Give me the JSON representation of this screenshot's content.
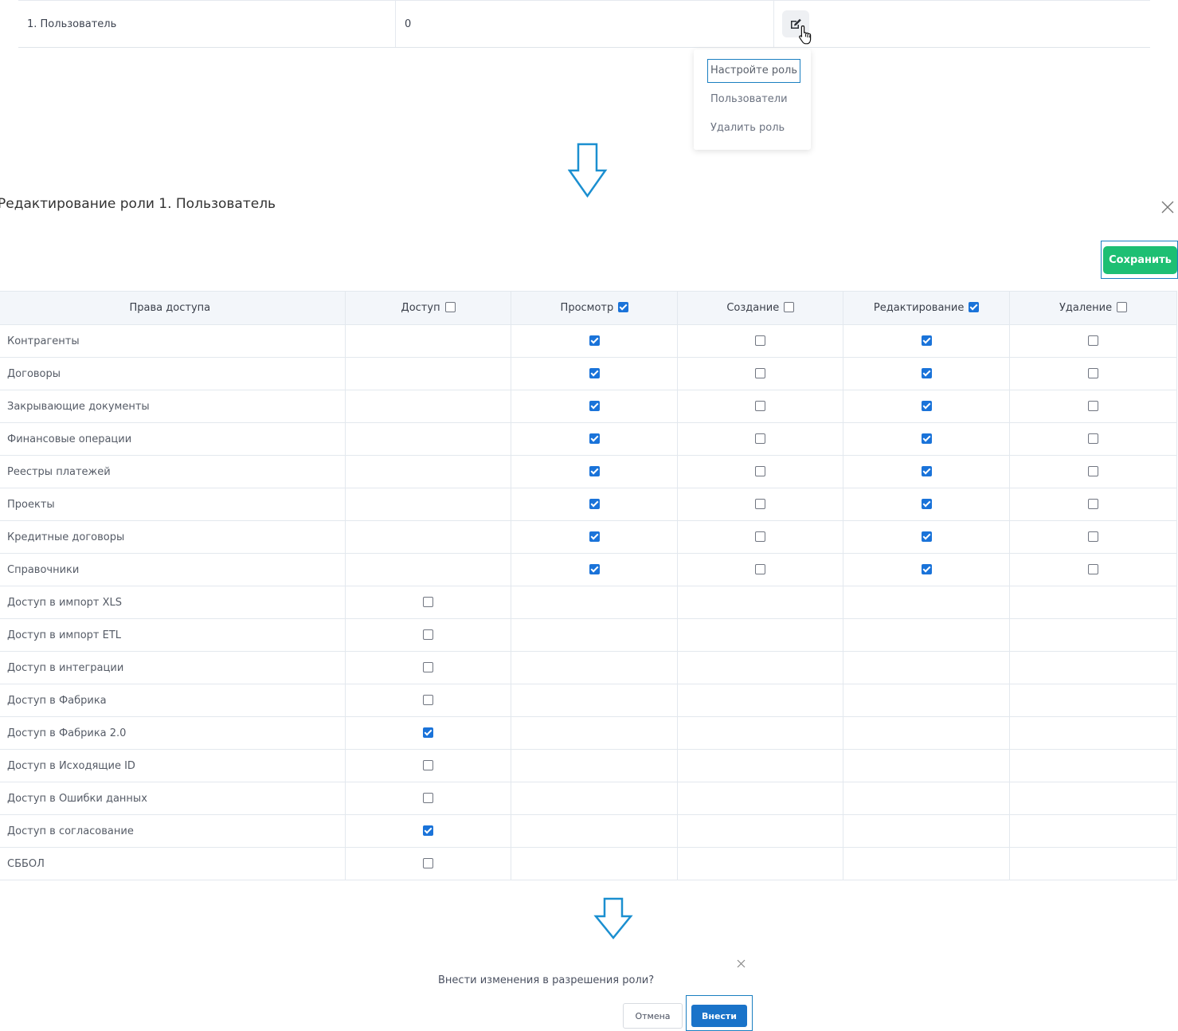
{
  "role_row": {
    "name": "1. Пользователь",
    "count": "0"
  },
  "dropdown": [
    "Настройте роль",
    "Пользователи",
    "Удалить роль"
  ],
  "modal": {
    "title": "Редактирование роли 1. Пользователь",
    "save_label": "Сохранить"
  },
  "columns": [
    {
      "label": "Права доступа"
    },
    {
      "label": "Доступ",
      "checked": false
    },
    {
      "label": "Просмотр",
      "checked": true
    },
    {
      "label": "Создание",
      "checked": false
    },
    {
      "label": "Редактирование",
      "checked": true
    },
    {
      "label": "Удаление",
      "checked": false
    }
  ],
  "rows": [
    {
      "name": "Контрагенты",
      "cells": [
        null,
        true,
        false,
        true,
        false
      ]
    },
    {
      "name": "Договоры",
      "cells": [
        null,
        true,
        false,
        true,
        false
      ]
    },
    {
      "name": "Закрывающие документы",
      "cells": [
        null,
        true,
        false,
        true,
        false
      ]
    },
    {
      "name": "Финансовые операции",
      "cells": [
        null,
        true,
        false,
        true,
        false
      ]
    },
    {
      "name": "Реестры платежей",
      "cells": [
        null,
        true,
        false,
        true,
        false
      ]
    },
    {
      "name": "Проекты",
      "cells": [
        null,
        true,
        false,
        true,
        false
      ]
    },
    {
      "name": "Кредитные договоры",
      "cells": [
        null,
        true,
        false,
        true,
        false
      ]
    },
    {
      "name": "Справочники",
      "cells": [
        null,
        true,
        false,
        true,
        false
      ]
    },
    {
      "name": "Доступ в импорт XLS",
      "cells": [
        false,
        null,
        null,
        null,
        null
      ]
    },
    {
      "name": "Доступ в импорт ETL",
      "cells": [
        false,
        null,
        null,
        null,
        null
      ]
    },
    {
      "name": "Доступ в интеграции",
      "cells": [
        false,
        null,
        null,
        null,
        null
      ]
    },
    {
      "name": "Доступ в Фабрика",
      "cells": [
        false,
        null,
        null,
        null,
        null
      ]
    },
    {
      "name": "Доступ в Фабрика 2.0",
      "cells": [
        true,
        null,
        null,
        null,
        null
      ]
    },
    {
      "name": "Доступ в Исходящие ID",
      "cells": [
        false,
        null,
        null,
        null,
        null
      ]
    },
    {
      "name": "Доступ в Ошибки данных",
      "cells": [
        false,
        null,
        null,
        null,
        null
      ]
    },
    {
      "name": "Доступ в согласование",
      "cells": [
        true,
        null,
        null,
        null,
        null
      ]
    },
    {
      "name": "СББОЛ",
      "cells": [
        false,
        null,
        null,
        null,
        null
      ]
    }
  ],
  "confirm": {
    "text": "Внести изменения в разрешения роли?",
    "cancel_label": "Отмена",
    "apply_label": "Внести"
  },
  "colors": {
    "accent": "#1a73d9",
    "save": "#1dbf73",
    "frame": "#1a7fc1"
  },
  "icons": [
    "edit-icon",
    "hand-cursor-icon",
    "down-arrow-icon",
    "close-icon"
  ]
}
